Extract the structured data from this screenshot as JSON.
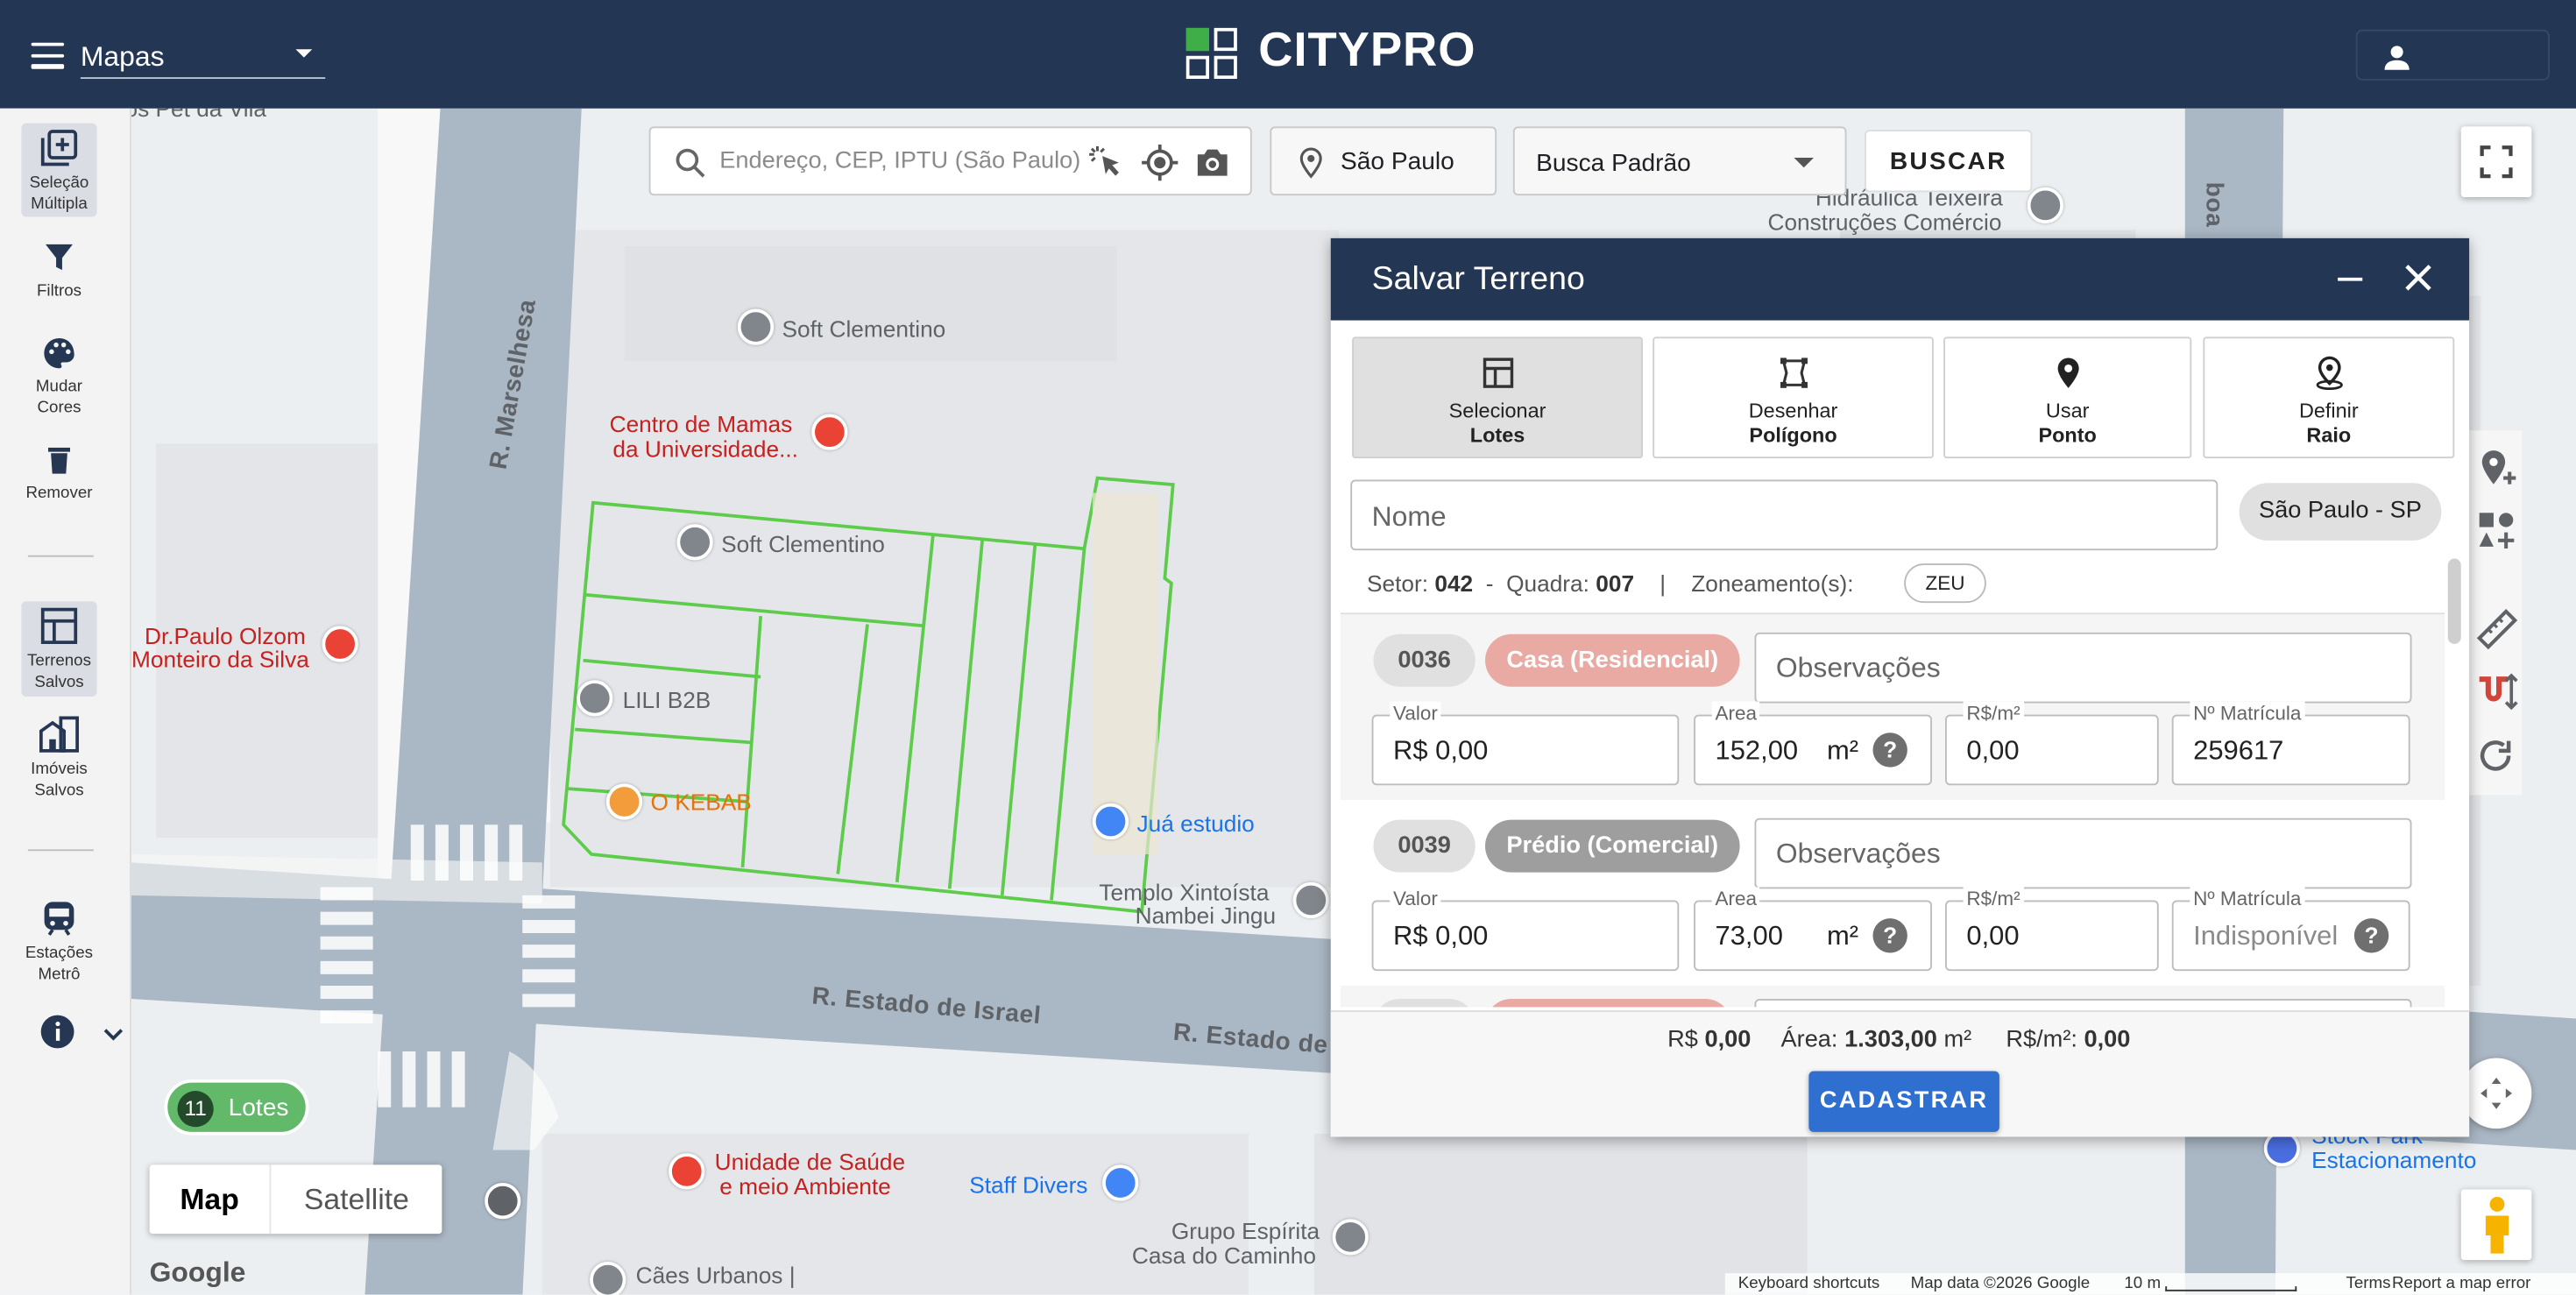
{
  "header": {
    "map_select_value": "Mapas",
    "logo_text": "CITYPRO"
  },
  "sidebar": {
    "items": [
      {
        "label": "Seleção Múltipla",
        "icon": "add-box-icon"
      },
      {
        "label": "Filtros",
        "icon": "filter-icon"
      },
      {
        "label": "Mudar Cores",
        "icon": "palette-icon"
      },
      {
        "label": "Remover",
        "icon": "trash-icon"
      },
      {
        "label": "Terrenos Salvos",
        "icon": "dashboard-icon"
      },
      {
        "label": "Imóveis Salvos",
        "icon": "buildings-icon"
      },
      {
        "label": "Estações Metrô",
        "icon": "subway-icon"
      }
    ]
  },
  "search": {
    "placeholder": "Endereço, CEP, IPTU (São Paulo)",
    "city": "São Paulo",
    "search_type": "Busca Padrão",
    "button": "BUSCAR"
  },
  "map": {
    "streets": [
      "R. Marselhesa",
      "R. Estado de Israel",
      "R. Estado de",
      "boa"
    ],
    "pois": [
      "Soft Clementino",
      "Centro de Mamas",
      "da Universidade...",
      "Soft Clementino",
      "Dr.Paulo Olzom",
      "Monteiro da Silva",
      "LILI B2B",
      "O KEBAB",
      "Juá estudio",
      "Templo Xintoísta",
      "Nambei Jingu",
      "Unidade de Saúde",
      "e meio Ambiente",
      "Staff Divers",
      "Grupo Espírita",
      "Casa do Caminho",
      "Cães Urbanos |",
      "Hidráulica Teixeira",
      "Construções Comércio",
      "Stock Park",
      "Estacionamento",
      "os Pet da Vila"
    ],
    "lotes_count": "11",
    "lotes_label": "Lotes",
    "map_type_map": "Map",
    "map_type_satellite": "Satellite",
    "google": "Google",
    "attribution": {
      "shortcuts": "Keyboard shortcuts",
      "data": "Map data ©2026 Google",
      "scale": "10 m",
      "terms": "Terms",
      "report": "Report a map error"
    }
  },
  "dialog": {
    "title": "Salvar Terreno",
    "modes": [
      {
        "line1": "Selecionar",
        "line2": "Lotes",
        "icon": "table-icon"
      },
      {
        "line1": "Desenhar",
        "line2": "Polígono",
        "icon": "polygon-icon"
      },
      {
        "line1": "Usar",
        "line2": "Ponto",
        "icon": "pin-icon"
      },
      {
        "line1": "Definir",
        "line2": "Raio",
        "icon": "radius-pin-icon"
      }
    ],
    "name_placeholder": "Nome",
    "city_chip": "São Paulo - SP",
    "setor_label": "Setor:",
    "setor": "042",
    "dash": "-",
    "quadra_label": "Quadra:",
    "quadra": "007",
    "sep": "|",
    "zoneamento_label": "Zoneamento(s):",
    "zoneamento": "ZEU",
    "rows": [
      {
        "lote": "0036",
        "uso": "Casa (Residencial)",
        "uso_color": "#e8aaa2",
        "obs_placeholder": "Observações",
        "valor_label": "Valor",
        "valor": "R$ 0,00",
        "area_label": "Area",
        "area": "152,00",
        "area_unit": "m²",
        "rsm2_label": "R$/m²",
        "rsm2": "0,00",
        "matricula_label": "Nº Matrícula",
        "matricula": "259617"
      },
      {
        "lote": "0039",
        "uso": "Prédio (Comercial)",
        "uso_color": "#9e9e9e",
        "obs_placeholder": "Observações",
        "valor_label": "Valor",
        "valor": "R$ 0,00",
        "area_label": "Area",
        "area": "73,00",
        "area_unit": "m²",
        "rsm2_label": "R$/m²",
        "rsm2": "0,00",
        "matricula_label": "Nº Matrícula",
        "matricula": "Indisponível"
      }
    ],
    "totals": {
      "rs_label": "R$",
      "rs": "0,00",
      "area_label": "Área:",
      "area": "1.303,00",
      "area_unit": "m²",
      "rsm2_label": "R$/m²:",
      "rsm2": "0,00"
    },
    "submit": "CADASTRAR"
  },
  "colors": {
    "header": "#233654",
    "primary": "#2f6fd0",
    "lot_outline": "#5ccc4a",
    "lotes_pill": "#63b96a"
  }
}
